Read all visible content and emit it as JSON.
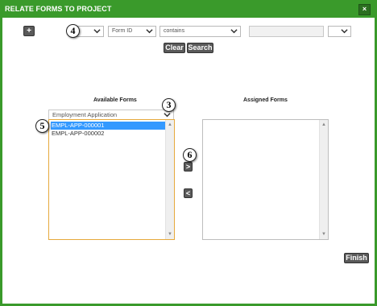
{
  "dialog": {
    "title": "RELATE FORMS TO PROJECT",
    "close_label": "×",
    "accent": "#3a9a2b"
  },
  "search": {
    "add_label": "+",
    "field_select": "Form ID",
    "operator_select": "contains",
    "value_placeholder": "",
    "clear_label": "Clear",
    "search_label": "Search"
  },
  "available": {
    "heading": "Available Forms",
    "category_select": "Employment Application",
    "items": [
      {
        "label": "EMPL-APP-000001",
        "selected": true
      },
      {
        "label": "EMPL-APP-000002",
        "selected": false
      }
    ]
  },
  "assigned": {
    "heading": "Assigned Forms",
    "items": []
  },
  "controls": {
    "assign_label": ">",
    "unassign_label": "<",
    "finish_label": "Finish"
  },
  "callouts": [
    "4",
    "3",
    "5",
    "6"
  ]
}
